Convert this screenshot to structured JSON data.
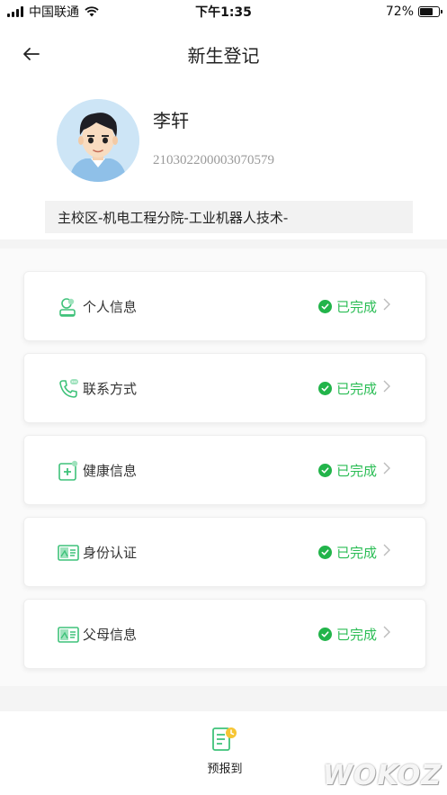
{
  "status_bar": {
    "carrier": "中国联通",
    "time": "下午1:35",
    "battery_text": "72%",
    "battery_level": 0.72
  },
  "header": {
    "title": "新生登记"
  },
  "profile": {
    "name": "李轩",
    "student_id": "210302200003070579",
    "department": "主校区-机电工程分院-工业机器人技术-"
  },
  "items": [
    {
      "label": "个人信息",
      "status": "已完成",
      "icon": "person-icon"
    },
    {
      "label": "联系方式",
      "status": "已完成",
      "icon": "phone-chat-icon"
    },
    {
      "label": "健康信息",
      "status": "已完成",
      "icon": "health-plus-icon"
    },
    {
      "label": "身份认证",
      "status": "已完成",
      "icon": "id-card-icon"
    },
    {
      "label": "父母信息",
      "status": "已完成",
      "icon": "id-card-icon"
    }
  ],
  "tab_bar": {
    "pre_report_label": "预报到"
  },
  "watermark": "WOKOZ",
  "colors": {
    "accent": "#2bbd55",
    "icon": "#3fc27a"
  }
}
